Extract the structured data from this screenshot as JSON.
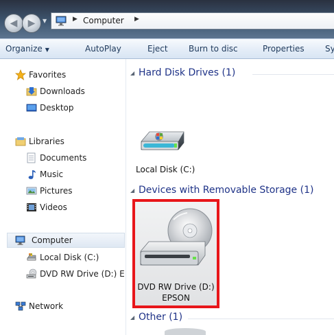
{
  "address_bar": {
    "path": [
      "Computer"
    ],
    "sep": "▶"
  },
  "toolbar": {
    "organize": "Organize",
    "autoplay": "AutoPlay",
    "eject": "Eject",
    "burn": "Burn to disc",
    "properties": "Properties",
    "overflow": "Sy"
  },
  "nav": {
    "favorites": "Favorites",
    "downloads": "Downloads",
    "desktop": "Desktop",
    "libraries": "Libraries",
    "documents": "Documents",
    "music": "Music",
    "pictures": "Pictures",
    "videos": "Videos",
    "computer": "Computer",
    "local_disk": "Local Disk (C:)",
    "dvd_drive": "DVD RW Drive (D:) E",
    "network": "Network"
  },
  "groups": {
    "hdd": "Hard Disk Drives (1)",
    "removable": "Devices with Removable Storage (1)",
    "other": "Other (1)"
  },
  "drives": {
    "local_disk": "Local Disk (C:)",
    "dvd_line1": "DVD RW Drive (D:)",
    "dvd_line2": "EPSON"
  },
  "colors": {
    "selection_outline": "#e8161a",
    "group_title": "#1e3287",
    "command_text": "#1e395b"
  },
  "icons": {
    "favorites": "star-icon",
    "downloads": "downloads-folder-icon",
    "desktop": "desktop-icon",
    "libraries": "library-icon",
    "documents": "document-icon",
    "music": "music-note-icon",
    "pictures": "pictures-icon",
    "videos": "video-icon",
    "computer": "computer-icon",
    "local_disk": "hard-drive-icon",
    "dvd": "dvd-drive-icon",
    "network": "network-icon"
  }
}
